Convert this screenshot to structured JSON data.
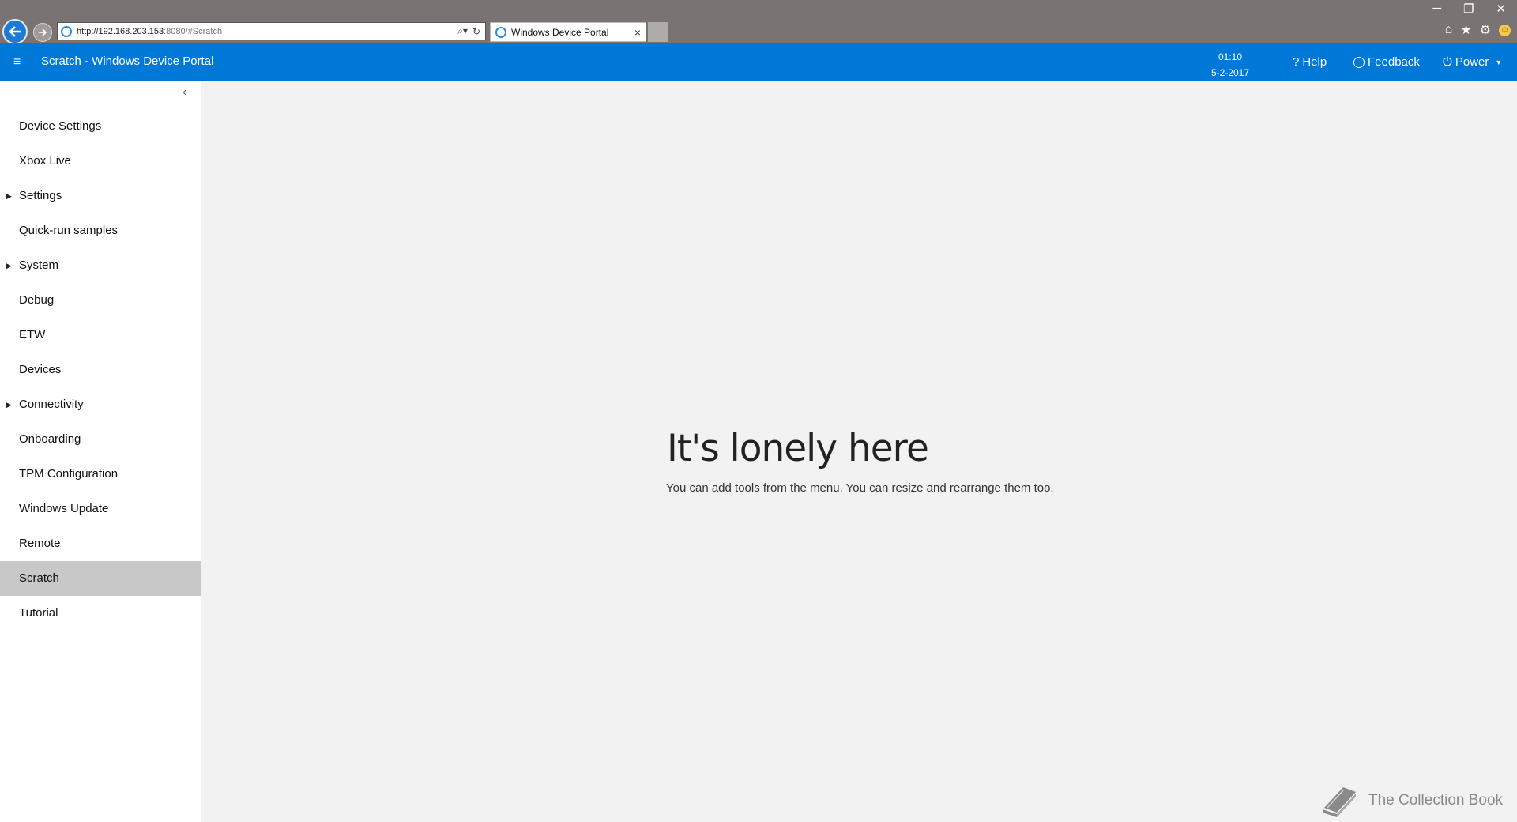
{
  "browser": {
    "url_host": "http://192.168.203.153",
    "url_rest": ":8080/#Scratch",
    "tab_title": "Windows Device Portal",
    "tab_close": "×"
  },
  "header": {
    "menu_icon": "≡",
    "title": "Scratch - Windows Device Portal",
    "time": "01:10",
    "date": "5-2-2017",
    "help_label": "Help",
    "feedback_label": "Feedback",
    "power_label": "Power"
  },
  "sidebar": {
    "collapse_icon": "‹",
    "items": [
      {
        "label": "Device Settings",
        "expandable": false
      },
      {
        "label": "Xbox Live",
        "expandable": false
      },
      {
        "label": "Settings",
        "expandable": true
      },
      {
        "label": "Quick-run samples",
        "expandable": false
      },
      {
        "label": "System",
        "expandable": true
      },
      {
        "label": "Debug",
        "expandable": false
      },
      {
        "label": "ETW",
        "expandable": false
      },
      {
        "label": "Devices",
        "expandable": false
      },
      {
        "label": "Connectivity",
        "expandable": true
      },
      {
        "label": "Onboarding",
        "expandable": false
      },
      {
        "label": "TPM Configuration",
        "expandable": false
      },
      {
        "label": "Windows Update",
        "expandable": false
      },
      {
        "label": "Remote",
        "expandable": false
      },
      {
        "label": "Scratch",
        "expandable": false,
        "active": true
      },
      {
        "label": "Tutorial",
        "expandable": false
      }
    ]
  },
  "main": {
    "title": "It's lonely here",
    "subtitle": "You can add tools from the menu. You can resize and rearrange them too."
  },
  "watermark": {
    "text": "The Collection Book"
  },
  "colors": {
    "header_bg": "#0078d7",
    "chrome_bg": "#7a7373",
    "active_item": "#c8c8c8",
    "page_bg": "#f2f2f2"
  }
}
